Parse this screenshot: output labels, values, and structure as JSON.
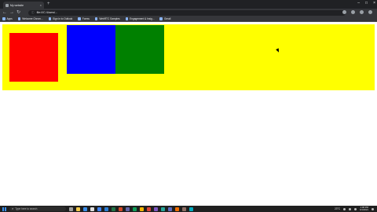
{
  "browser": {
    "tab_title": "My website",
    "new_tab_glyph": "+",
    "url": "file:///C:/Users/...",
    "bookmarks": [
      {
        "label": "Apps"
      },
      {
        "label": "Welcome Chrom..."
      },
      {
        "label": "Sign in to Outlook"
      },
      {
        "label": "Forms"
      },
      {
        "label": "WebRTC Samples"
      },
      {
        "label": "Engagement & Insig..."
      },
      {
        "label": "Gmail"
      }
    ]
  },
  "page": {
    "colors": {
      "container": "#ffff00",
      "box1": "#ff0000",
      "box2": "#0000ff",
      "box3": "#008000"
    }
  },
  "taskbar": {
    "search_placeholder": "Type here to search",
    "weather": "23°C",
    "time": "1:08 PM",
    "date": "6/1/2021"
  }
}
